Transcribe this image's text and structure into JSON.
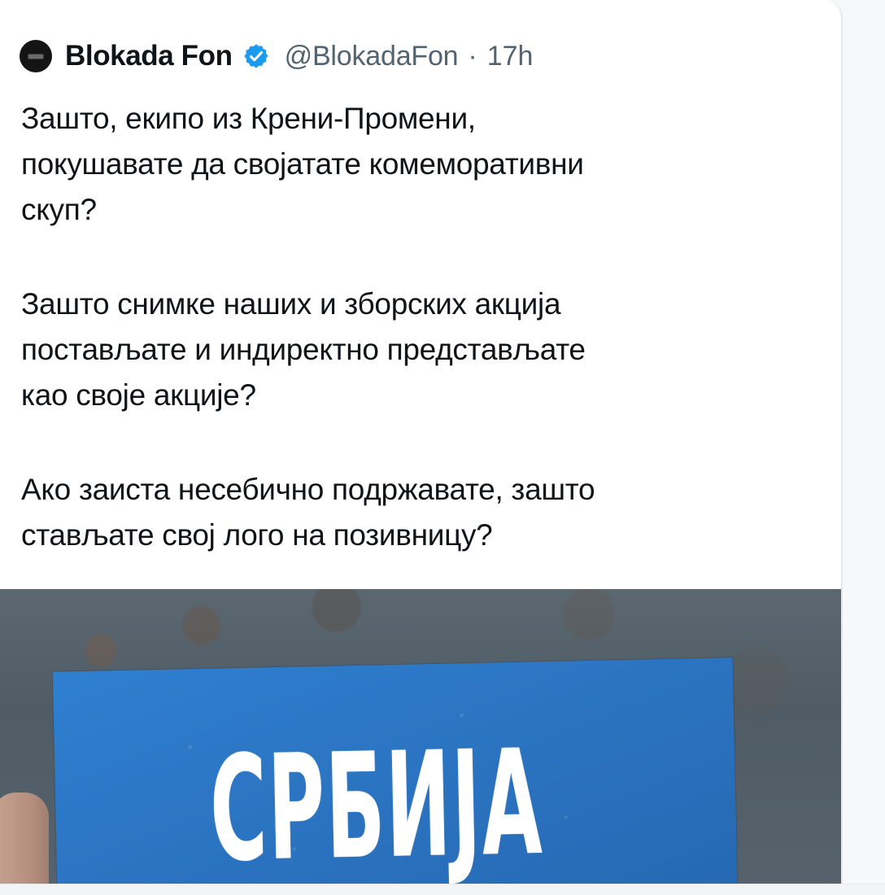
{
  "tweet": {
    "author": {
      "display_name": "Blokada Fon",
      "handle": "@BlokadaFon",
      "verified": true,
      "avatar_icon": "avatar-logo"
    },
    "separator": "·",
    "timestamp": "17h",
    "paragraphs": [
      "Зашто, екипо из Крени-Промени,\nпокушавате да својатате комеморативни\nскуп?",
      "Зашто снимке наших и зборских акција\nпостављате и индиректно представљате\nкао своје акције?",
      "Ако заиста несебично подржавате, зашто\nстављате свој лого на позивницу?"
    ],
    "media": {
      "poster_title": "СРБИЈА",
      "poster_subtitle": "",
      "poster_color": "#2b74c2"
    },
    "colors": {
      "text": "#0f1419",
      "muted": "#536471",
      "verified": "#1d9bf0"
    }
  }
}
